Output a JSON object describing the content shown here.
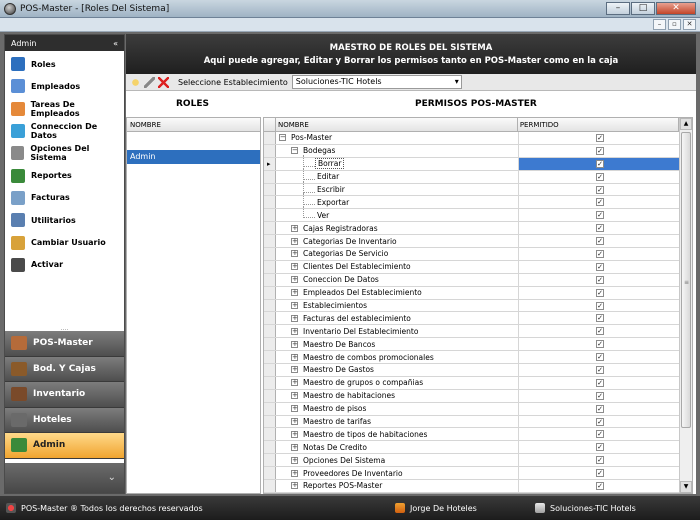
{
  "window": {
    "title": "POS-Master - [Roles Del Sistema]",
    "min_label": "–",
    "max_label": "□",
    "close_label": "✕",
    "inner_min_label": "–",
    "inner_restore_label": "▫",
    "inner_close_label": "✕"
  },
  "sidebar": {
    "header": "Admin",
    "collapse_label": "«",
    "splitter_label": "....",
    "items": [
      {
        "label": "Roles",
        "icon": "roles-icon",
        "color": "#2d6fbe"
      },
      {
        "label": "Empleados",
        "icon": "employees-icon",
        "color": "#5b8fd6"
      },
      {
        "label": "Tareas De Empleados",
        "icon": "calendar-icon",
        "color": "#e5893a"
      },
      {
        "label": "Conneccion De Datos",
        "icon": "globe-icon",
        "color": "#3aa0d8"
      },
      {
        "label": "Opciones Del Sistema",
        "icon": "gears-icon",
        "color": "#8a8a8a"
      },
      {
        "label": "Reportes",
        "icon": "chart-icon",
        "color": "#3a8a3a"
      },
      {
        "label": "Facturas",
        "icon": "invoice-icon",
        "color": "#7aa0c8"
      },
      {
        "label": "Utilitarios",
        "icon": "tools-icon",
        "color": "#5a7fb0"
      },
      {
        "label": "Cambiar Usuario",
        "icon": "user-icon",
        "color": "#d8a23a"
      },
      {
        "label": "Activar",
        "icon": "activate-icon",
        "color": "#4a4a4a"
      }
    ],
    "sections": [
      {
        "label": "POS-Master",
        "icon": "home-icon",
        "active": false
      },
      {
        "label": "Bod. Y Cajas",
        "icon": "warehouse-icon",
        "active": false
      },
      {
        "label": "Inventario",
        "icon": "inventory-icon",
        "active": false
      },
      {
        "label": "Hoteles",
        "icon": "hotel-icon",
        "active": false
      },
      {
        "label": "Admin",
        "icon": "admin-icon",
        "active": true
      }
    ],
    "footer_label": "⌄"
  },
  "banner": {
    "line1": "MAESTRO DE ROLES DEL SISTEMA",
    "line2": "Aqui puede agregar, Editar y Borrar los permisos tanto en POS-Master como en la caja"
  },
  "toolbar": {
    "select_label": "Seleccione Establecimiento",
    "select_value": "Soluciones-TIC Hotels"
  },
  "roles": {
    "title": "ROLES",
    "column": "NOMBRE",
    "rows": [
      "Admin"
    ]
  },
  "perms": {
    "title": "PERMISOS POS-MASTER",
    "col_name": "NOMBRE",
    "col_perm": "PERMITIDO",
    "check_mark": "✓",
    "expanded_sign": "−",
    "collapsed_sign": "+",
    "rows": [
      {
        "label": "Pos-Master",
        "level": 0,
        "expander": "minus"
      },
      {
        "label": "Bodegas",
        "level": 1,
        "expander": "minus"
      },
      {
        "label": "Borrar",
        "level": 2,
        "expander": "none",
        "selected": true
      },
      {
        "label": "Editar",
        "level": 2,
        "expander": "none"
      },
      {
        "label": "Escribir",
        "level": 2,
        "expander": "none"
      },
      {
        "label": "Exportar",
        "level": 2,
        "expander": "none"
      },
      {
        "label": "Ver",
        "level": 2,
        "expander": "none"
      },
      {
        "label": "Cajas Registradoras",
        "level": 1,
        "expander": "plus"
      },
      {
        "label": "Categorias De Inventario",
        "level": 1,
        "expander": "plus"
      },
      {
        "label": "Categorias De Servicio",
        "level": 1,
        "expander": "plus"
      },
      {
        "label": "Clientes Del Establecimiento",
        "level": 1,
        "expander": "plus"
      },
      {
        "label": "Coneccion De Datos",
        "level": 1,
        "expander": "plus"
      },
      {
        "label": "Empleados Del Establecimiento",
        "level": 1,
        "expander": "plus"
      },
      {
        "label": "Establecimientos",
        "level": 1,
        "expander": "plus"
      },
      {
        "label": "Facturas del establecimiento",
        "level": 1,
        "expander": "plus"
      },
      {
        "label": "Inventario Del Establecimiento",
        "level": 1,
        "expander": "plus"
      },
      {
        "label": "Maestro De Bancos",
        "level": 1,
        "expander": "plus"
      },
      {
        "label": "Maestro de combos promocionales",
        "level": 1,
        "expander": "plus"
      },
      {
        "label": "Maestro De Gastos",
        "level": 1,
        "expander": "plus"
      },
      {
        "label": "Maestro de grupos o compañias",
        "level": 1,
        "expander": "plus"
      },
      {
        "label": "Maestro de habitaciones",
        "level": 1,
        "expander": "plus"
      },
      {
        "label": "Maestro de pisos",
        "level": 1,
        "expander": "plus"
      },
      {
        "label": "Maestro de tarifas",
        "level": 1,
        "expander": "plus"
      },
      {
        "label": "Maestro de tipos de habitaciones",
        "level": 1,
        "expander": "plus"
      },
      {
        "label": "Notas De Credito",
        "level": 1,
        "expander": "plus"
      },
      {
        "label": "Opciones Del Sistema",
        "level": 1,
        "expander": "plus"
      },
      {
        "label": "Proveedores De Inventario",
        "level": 1,
        "expander": "plus"
      },
      {
        "label": "Reportes POS-Master",
        "level": 1,
        "expander": "plus"
      }
    ]
  },
  "statusbar": {
    "left": "POS-Master ®  Todos los derechos reservados",
    "user": "Jorge  De Hoteles",
    "establishment": "Soluciones-TIC Hotels"
  }
}
